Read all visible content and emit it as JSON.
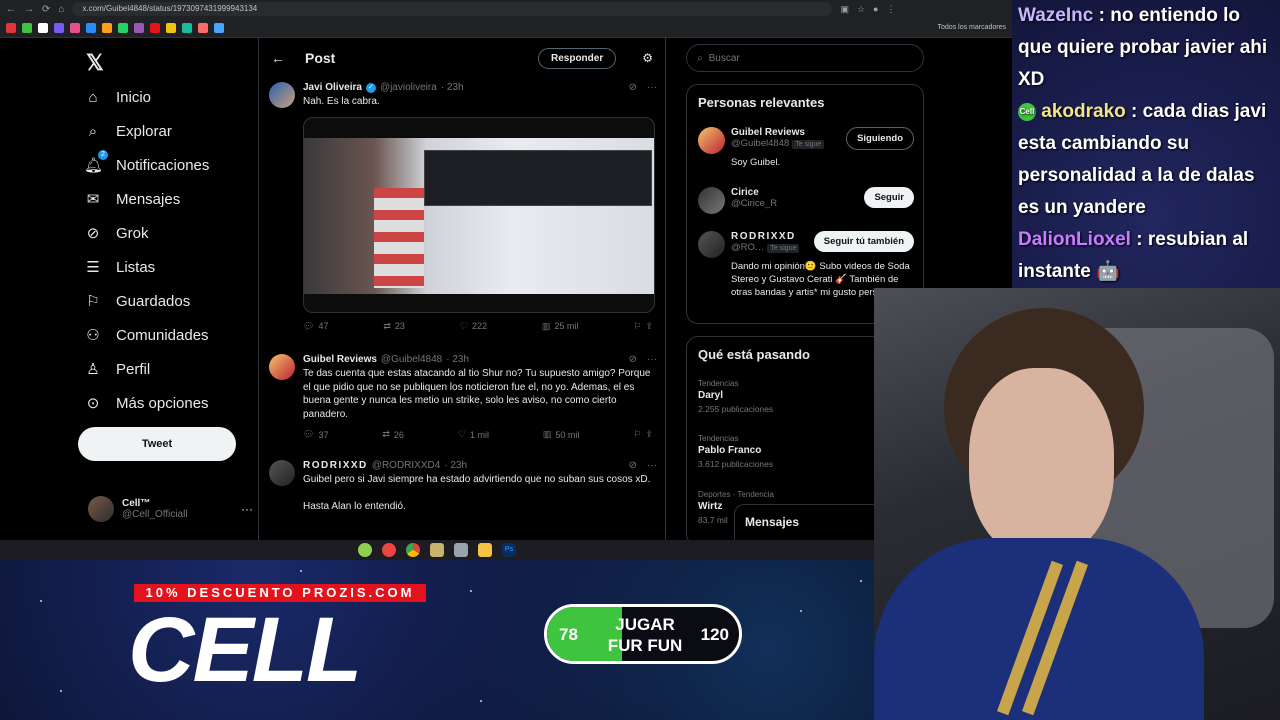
{
  "browser": {
    "url": "x.com/Guibel4848/status/1973097431999943134",
    "bookmarks_folder": "Todos los marcadores"
  },
  "nav": {
    "items": [
      {
        "label": "Inicio",
        "icon": "home-icon"
      },
      {
        "label": "Explorar",
        "icon": "search-icon"
      },
      {
        "label": "Notificaciones",
        "icon": "bell-icon",
        "badge": "2"
      },
      {
        "label": "Mensajes",
        "icon": "mail-icon"
      },
      {
        "label": "Grok",
        "icon": "grok-icon"
      },
      {
        "label": "Listas",
        "icon": "list-icon"
      },
      {
        "label": "Guardados",
        "icon": "bookmark-icon"
      },
      {
        "label": "Comunidades",
        "icon": "people-icon"
      },
      {
        "label": "Perfil",
        "icon": "person-icon"
      },
      {
        "label": "Más opciones",
        "icon": "more-circle-icon"
      }
    ],
    "tweet_button": "Tweet",
    "account": {
      "name": "Cell™",
      "handle": "@Cell_Officiall"
    }
  },
  "post": {
    "header_title": "Post",
    "reply_button": "Responder",
    "tweets": [
      {
        "name": "Javi Oliveira",
        "handle": "@javioliveira",
        "time": "· 23h",
        "text": "Nah. Es la cabra.",
        "stats": {
          "replies": "47",
          "retweets": "23",
          "likes": "222",
          "views": "25 mil"
        }
      },
      {
        "name": "Guibel Reviews",
        "handle": "@Guibel4848",
        "time": "· 23h",
        "text": "Te das cuenta que estas atacando al tio Shur no? Tu supuesto amigo? Porque el que pidio que no se publiquen los noticieron fue el, no yo. Ademas, el es buena gente y nunca les metio un strike, solo les aviso, no como cierto panadero.",
        "stats": {
          "replies": "37",
          "retweets": "26",
          "likes": "1 mil",
          "views": "50 mil"
        }
      },
      {
        "name": "RODRIXXD",
        "handle": "@RODRIXXD4",
        "time": "· 23h",
        "text": "Guibel pero si Javi siempre ha estado advirtiendo que no suban sus cosos xD.",
        "text2": "Hasta Alan lo entendió."
      }
    ]
  },
  "sidebar": {
    "search_placeholder": "Buscar",
    "relevant_title": "Personas relevantes",
    "people": [
      {
        "name": "Guibel Reviews",
        "handle": "@Guibel4848",
        "tag": "Te sigue",
        "bio": "Soy Guibel.",
        "button": "Siguiendo"
      },
      {
        "name": "Cirice",
        "handle": "@Cirice_R",
        "button": "Seguir"
      },
      {
        "name": "RODRIXXD",
        "handle": "@RO…",
        "tag": "Te sigue",
        "bio": "Dando mi opinión🙂 Subo videos de Soda Stereo y Gustavo Cerati 🎸 También de otras bandas y artis* mi gusto personal.",
        "button": "Seguir tú también"
      }
    ],
    "trending_title": "Qué está pasando",
    "trends": [
      {
        "category": "Tendencias",
        "name": "Daryl",
        "count": "2.255 publicaciones"
      },
      {
        "category": "Tendencias",
        "name": "Pablo Franco",
        "count": "3.612 publicaciones"
      },
      {
        "category": "Deportes · Tendencia",
        "name": "Wirtz",
        "count": "83,7 mil"
      }
    ],
    "messages_label": "Mensajes"
  },
  "chat": {
    "messages": [
      {
        "user": "WazeInc",
        "text": " : no entiendo lo que quiere probar javier ahi XD"
      },
      {
        "user": "akodrako",
        "badge": "Cell",
        "text": " : cada dias javi esta cambiando su personalidad a la de dalas es un yandere"
      },
      {
        "user": "DalionLioxel",
        "text": " : resubian al instante 🤖"
      }
    ]
  },
  "overlay": {
    "promo": "10% DESCUENTO PROZIS.COM",
    "logo": "CELL",
    "game": {
      "left_value": "78",
      "label": "JUGAR FUR FUN",
      "right_value": "120",
      "progress": 0.39
    },
    "colors": {
      "promo_red": "#e3121c",
      "game_green": "#3ec43e"
    }
  }
}
